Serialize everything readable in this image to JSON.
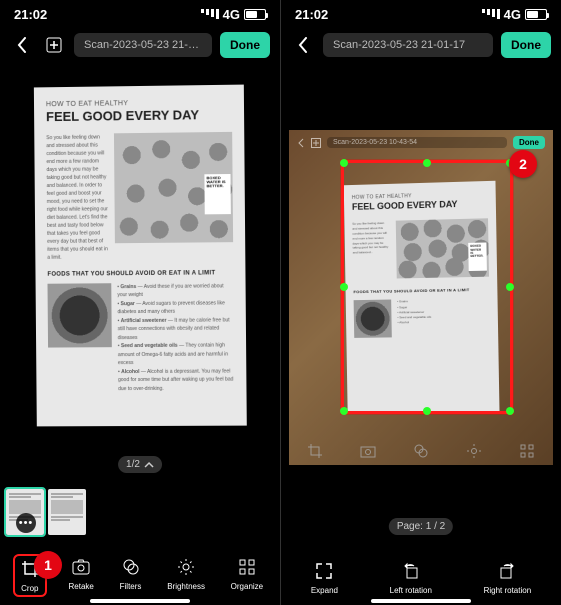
{
  "status": {
    "time": "21:02",
    "network": "4G"
  },
  "header": {
    "title": "Scan-2023-05-23 21-01-17",
    "done": "Done"
  },
  "right_inner_header": {
    "title": "Scan-2023-05-23 10-43-54",
    "done": "Done"
  },
  "doc": {
    "eyebrow": "HOW TO EAT HEALTHY",
    "title": "FEEL GOOD EVERY DAY",
    "boxed": "BOXED WATER IS BETTER.",
    "sub": "FOODS THAT YOU SHOULD AVOID OR EAT IN A LIMIT",
    "bullet_items": [
      "Grains",
      "Sugar",
      "Artificial sweetener",
      "Seed and vegetable oils",
      "Alcohol"
    ]
  },
  "page_indicator_left": "1/2",
  "page_indicator_right": "Page: 1 / 2",
  "toolbar_left": {
    "crop": "Crop",
    "retake": "Retake",
    "filters": "Filters",
    "brightness": "Brightness",
    "organize": "Organize"
  },
  "toolbar_right": {
    "expand": "Expand",
    "left_rot": "Left rotation",
    "right_rot": "Right rotation"
  },
  "badges": {
    "one": "1",
    "two": "2"
  }
}
